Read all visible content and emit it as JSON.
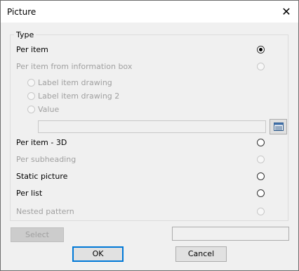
{
  "window": {
    "title": "Picture"
  },
  "group": {
    "label": "Type"
  },
  "options": [
    {
      "label": "Per item",
      "checked": true,
      "enabled": true
    },
    {
      "label": "Per item from information box",
      "checked": false,
      "enabled": false
    },
    {
      "label": "Per item - 3D",
      "checked": false,
      "enabled": true
    },
    {
      "label": "Per subheading",
      "checked": false,
      "enabled": false
    },
    {
      "label": "Static picture",
      "checked": false,
      "enabled": true
    },
    {
      "label": "Per list",
      "checked": false,
      "enabled": true
    },
    {
      "label": "Nested pattern",
      "checked": false,
      "enabled": false
    }
  ],
  "suboptions": [
    {
      "label": "Label item drawing"
    },
    {
      "label": "Label item drawing 2"
    },
    {
      "label": "Value"
    }
  ],
  "buttons": {
    "select": "Select",
    "ok": "OK",
    "cancel": "Cancel"
  },
  "icons": {
    "close": "close-icon",
    "browse": "list-browse-icon"
  }
}
